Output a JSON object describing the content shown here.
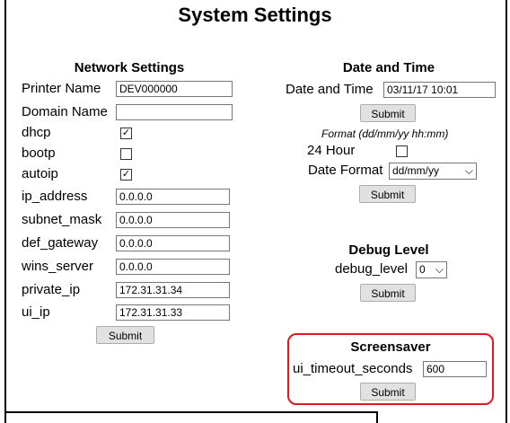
{
  "title": "System Settings",
  "network": {
    "heading": "Network Settings",
    "printer_name": {
      "label": "Printer Name",
      "value": "DEV000000"
    },
    "domain_name": {
      "label": "Domain Name",
      "value": ""
    },
    "dhcp": {
      "label": "dhcp",
      "checked": true
    },
    "bootp": {
      "label": "bootp",
      "checked": false
    },
    "autoip": {
      "label": "autoip",
      "checked": true
    },
    "ip_address": {
      "label": "ip_address",
      "value": "0.0.0.0"
    },
    "subnet_mask": {
      "label": "subnet_mask",
      "value": "0.0.0.0"
    },
    "def_gateway": {
      "label": "def_gateway",
      "value": "0.0.0.0"
    },
    "wins_server": {
      "label": "wins_server",
      "value": "0.0.0.0"
    },
    "private_ip": {
      "label": "private_ip",
      "value": "172.31.31.34"
    },
    "ui_ip": {
      "label": "ui_ip",
      "value": "172.31.31.33"
    },
    "submit_label": "Submit"
  },
  "date_time": {
    "heading": "Date and Time",
    "label": "Date and Time",
    "value": "03/11/17 10:01",
    "submit_label": "Submit",
    "format_hint": "Format (dd/mm/yy hh:mm)",
    "hour24": {
      "label": "24 Hour",
      "checked": false
    },
    "date_format": {
      "label": "Date Format",
      "value": "dd/mm/yy"
    },
    "submit2_label": "Submit"
  },
  "debug": {
    "heading": "Debug Level",
    "label": "debug_level",
    "value": "0",
    "submit_label": "Submit"
  },
  "screensaver": {
    "heading": "Screensaver",
    "label": "ui_timeout_seconds",
    "value": "600",
    "submit_label": "Submit",
    "highlight_color": "#e4161e"
  },
  "icons": {
    "check": "✓",
    "chevron": "⌵"
  }
}
